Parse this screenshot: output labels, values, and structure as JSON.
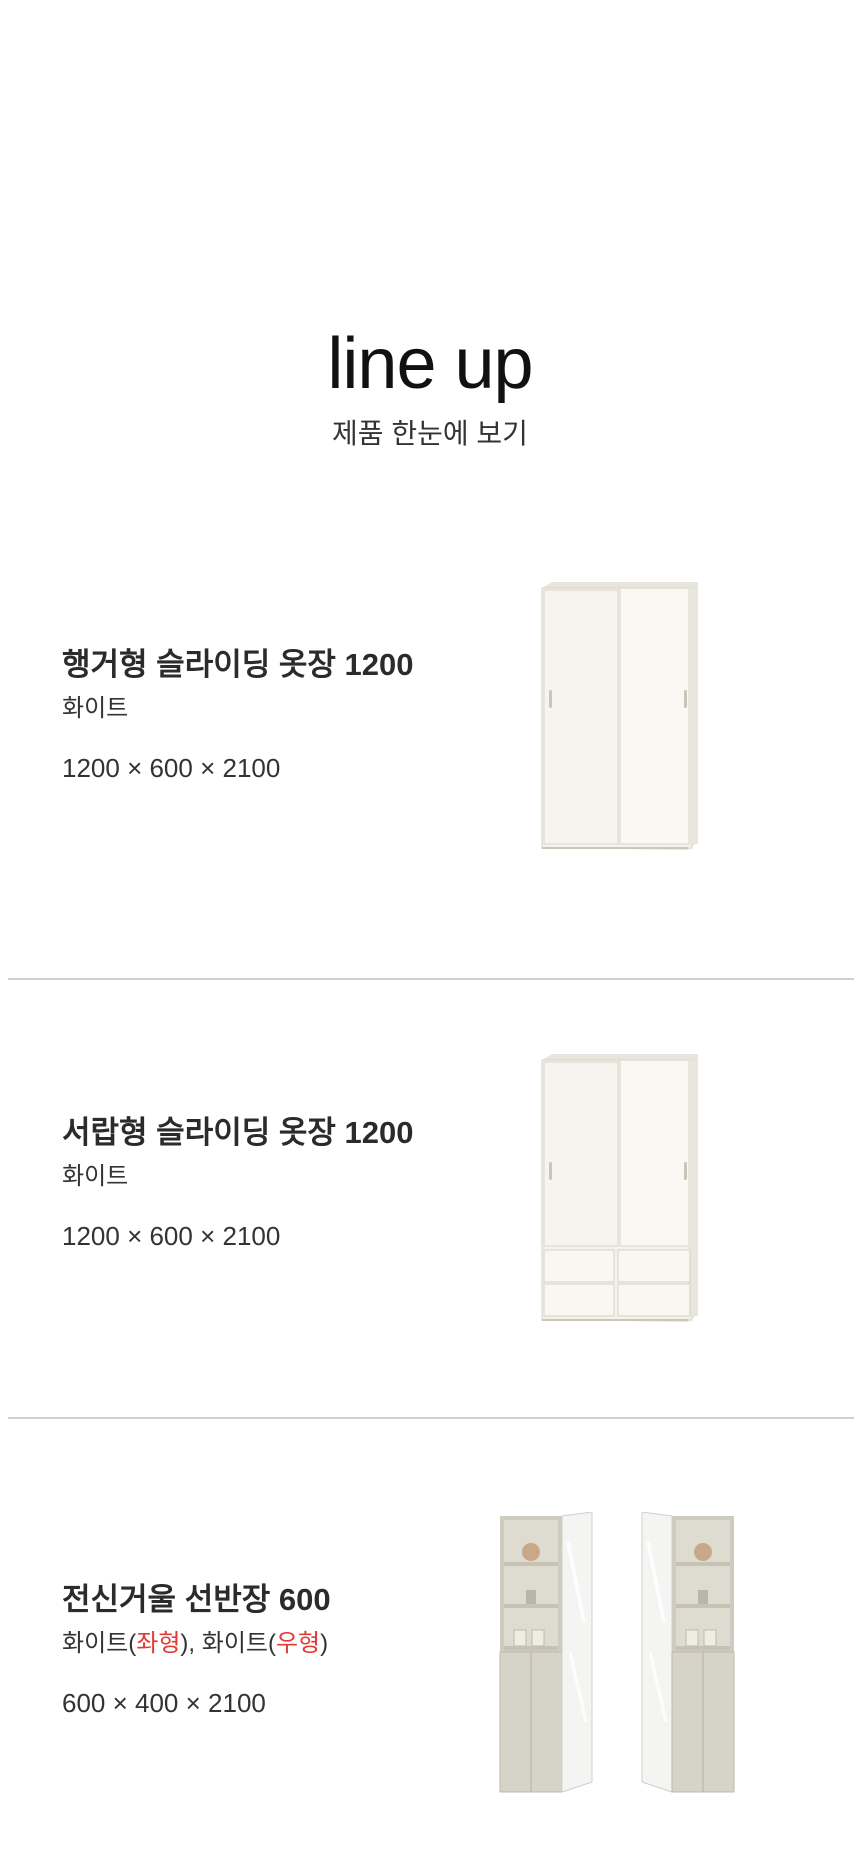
{
  "header": {
    "title": "line up",
    "subtitle": "제품 한눈에 보기"
  },
  "products": [
    {
      "name": "행거형 슬라이딩 옷장 1200",
      "color": "화이트",
      "dims": "1200 × 600 × 2100",
      "image": "wardrobe-two-sliding-doors"
    },
    {
      "name": "서랍형 슬라이딩 옷장 1200",
      "color": "화이트",
      "dims": "1200 × 600 × 2100",
      "image": "wardrobe-sliding-doors-with-drawers"
    },
    {
      "name": "전신거울 선반장 600",
      "color_parts": {
        "p1": "화이트(",
        "a1": "좌형",
        "p2": "), 화이트(",
        "a2": "우형",
        "p3": ")"
      },
      "dims": "600 × 400 × 2100",
      "image": "mirror-shelf-cabinet-left-and-right"
    }
  ],
  "colors": {
    "accent": "#e53935",
    "divider": "#d0d0d0",
    "cabinet": "#f3f1ea"
  }
}
